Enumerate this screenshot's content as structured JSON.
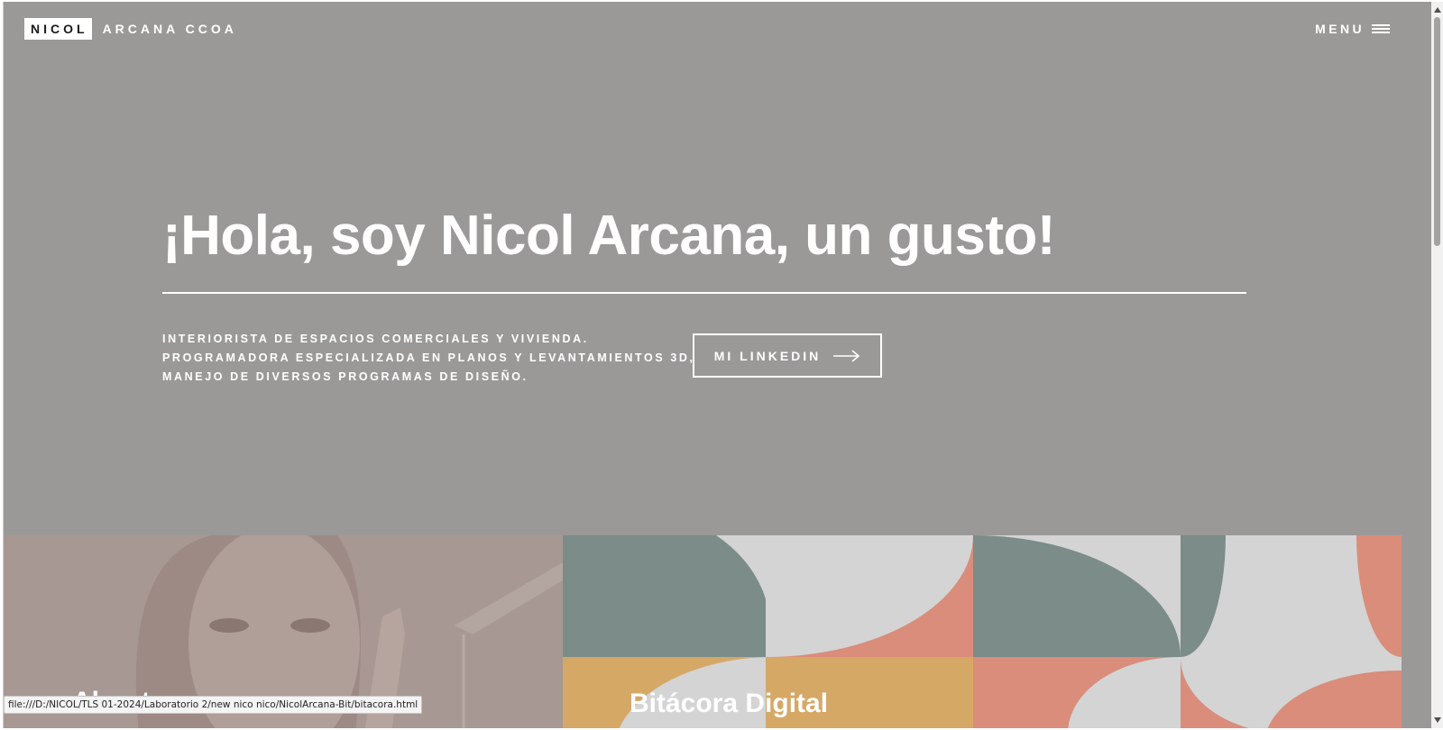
{
  "header": {
    "brand_box": "NICOL",
    "brand_rest": "ARCANA CCOA",
    "menu_label": "MENU"
  },
  "hero": {
    "title": "¡Hola, soy Nicol Arcana, un gusto!",
    "description_lines": [
      "INTERIORISTA DE ESPACIOS COMERCIALES Y VIVIENDA.",
      "PROGRAMADORA ESPECIALIZADA EN PLANOS Y LEVANTAMIENTOS 3D,",
      "MANEJO DE DIVERSOS PROGRAMAS DE DISEÑO."
    ],
    "cta_label": "MI LINKEDIN"
  },
  "panels": {
    "left_title": "About",
    "right_title": "Bitácora Digital"
  },
  "status_bar": {
    "url": "file:///D:/NICOL/TLS 01-2024/Laboratorio 2/new nico nico/NicolArcana-Bit/bitacora.html"
  },
  "colors": {
    "hero_overlay": "#9a9998",
    "about_panel": "#a89893",
    "pattern_teal": "#7b8c89",
    "pattern_coral": "#d98d7a",
    "pattern_gold": "#d6a866",
    "pattern_grey": "#d4d4d4"
  },
  "icons": {
    "menu": "hamburger-icon",
    "cta": "arrow-right-icon"
  }
}
